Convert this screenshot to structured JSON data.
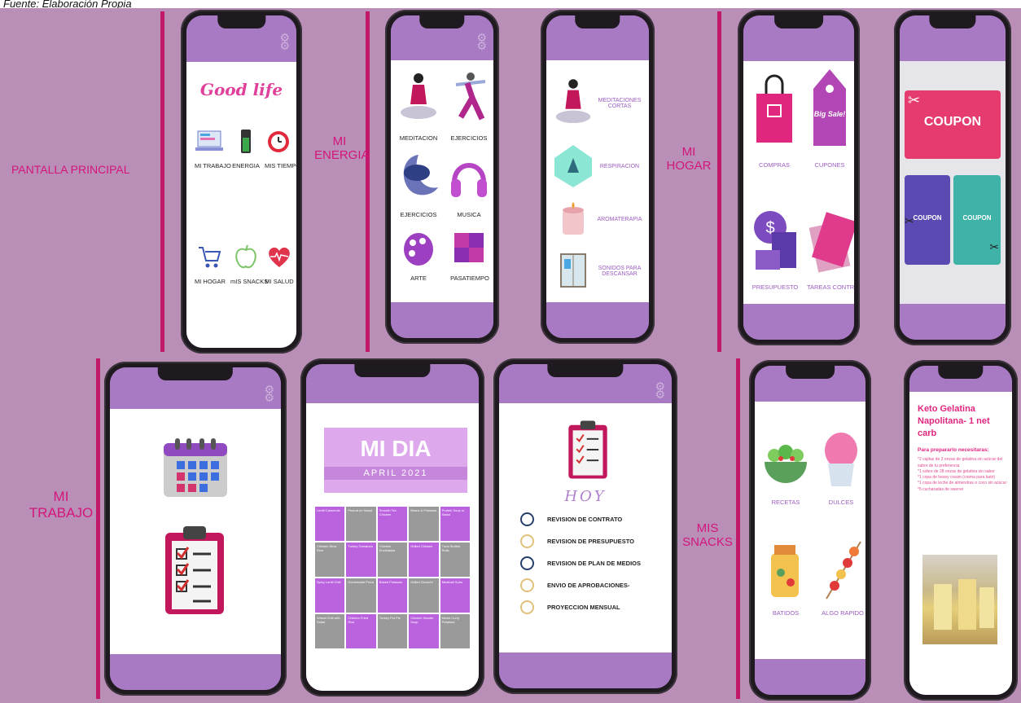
{
  "caption": "Fuente: Elaboración Propia",
  "sections": {
    "pantalla_principal": "PANTALLA PRINCIPAL",
    "mi_energia": [
      "MI",
      "ENERGIA"
    ],
    "mi_hogar": [
      "MI",
      "HOGAR"
    ],
    "mi_trabajo": [
      "MI",
      "TRABAJO"
    ],
    "mis_snacks": [
      "MIS",
      "SNACKS"
    ]
  },
  "home": {
    "title": "Good life",
    "tiles": [
      {
        "label": "MI TRABAJO",
        "icon": "laptop-icon"
      },
      {
        "label": "ENERGIA",
        "icon": "battery-icon"
      },
      {
        "label": "MIS TIEMPOS",
        "icon": "alarm-clock-icon"
      },
      {
        "label": "MI HOGAR",
        "icon": "cart-icon"
      },
      {
        "label": "mIS SNACKS",
        "icon": "apple-icon"
      },
      {
        "label": "MI SALUD",
        "icon": "heart-icon"
      }
    ]
  },
  "energia": {
    "tiles": [
      {
        "label": "MEDITACION",
        "icon": "meditation-icon"
      },
      {
        "label": "EJERCICIOS",
        "icon": "yoga-icon"
      },
      {
        "label": "EJERCICIOS",
        "icon": "sleep-moon-icon"
      },
      {
        "label": "MUSICA",
        "icon": "headphones-icon"
      },
      {
        "label": "ARTE",
        "icon": "palette-icon"
      },
      {
        "label": "PASATIEMPO",
        "icon": "puzzle-icon"
      }
    ]
  },
  "meditaciones": {
    "items": [
      {
        "label": "MEDITACIONES CORTAS",
        "icon": "meditation-icon"
      },
      {
        "label": "RESPIRACION",
        "icon": "breath-icon"
      },
      {
        "label": "AROMATERAPIA",
        "icon": "candle-icon"
      },
      {
        "label": "SONIDOS PARA DESCANSAR",
        "icon": "window-icon"
      }
    ]
  },
  "hogar": {
    "tiles": [
      {
        "label": "COMPRAS",
        "icon": "shopping-bag-icon"
      },
      {
        "label": "CUPONES",
        "icon": "sale-tag-icon"
      },
      {
        "label": "PRESUPUESTO",
        "icon": "coins-icon"
      },
      {
        "label": "TAREAS CONTROL",
        "icon": "notebook-icon"
      }
    ],
    "sale_tag": "Big Sale!"
  },
  "coupons": {
    "big": "COUPON",
    "left": "COUPON",
    "right": "COUPON"
  },
  "midia": {
    "title": "MI DIA",
    "subtitle": "APRIL 2021",
    "cells": [
      "Lentil Casserole",
      "Peanut on Salad",
      "Smooth Tex Chicken",
      "Beans & Potatoes",
      "Protein Soup or Salad",
      "Chicken Stew Rice",
      "Turkey Tomatoes",
      "Chicken Enchiladas",
      "Grilled Chicken",
      "Tuna Stuffed Rolls",
      "Spicy Lentil Chili",
      "Homemade Pizza",
      "Baked Potatoes",
      "Grilled Gnocchi",
      "Meatball Subs",
      "Wheat Chili with Salad",
      "Chicken Fried Rice",
      "Turkey Pot Pie",
      "Chicken Noodle Soup",
      "Mixed Curry Potatoes"
    ]
  },
  "hoy": {
    "title": "HOY",
    "tasks": [
      "REVISION DE CONTRATO",
      "REVISION DE PRESUPUESTO",
      "REVISION DE PLAN DE MEDIOS",
      "ENVIO DE APROBACIONES-",
      "PROYECCION MENSUAL"
    ]
  },
  "snacks": {
    "tiles": [
      {
        "label": "RECETAS",
        "icon": "salad-bowl-icon"
      },
      {
        "label": "DULCES",
        "icon": "cupcake-icon"
      },
      {
        "label": "BATIDOS",
        "icon": "smoothie-icon"
      },
      {
        "label": "ALGO RAPIDO",
        "icon": "skewer-icon"
      }
    ]
  },
  "recipe": {
    "title": "Keto Gelatina Napolitana- 1 net carb",
    "subtitle": "Para prepararlo necesitaras:",
    "lines": [
      "*2 cajitas de 3 onzas de gelatina sin azúcar del sabor de tu preferencia",
      "*1 sobre de 28 onzas de gelatina sin sabor",
      "*1 copa de heavy cream (crema para batir)",
      "*1 copa de leche de almendras o coco sin azúcar",
      "*5 cucharadas de swerve"
    ]
  },
  "colors": {
    "board": "#b98fb8",
    "accent": "#d4157a",
    "phone_bar": "#a87ac3"
  }
}
